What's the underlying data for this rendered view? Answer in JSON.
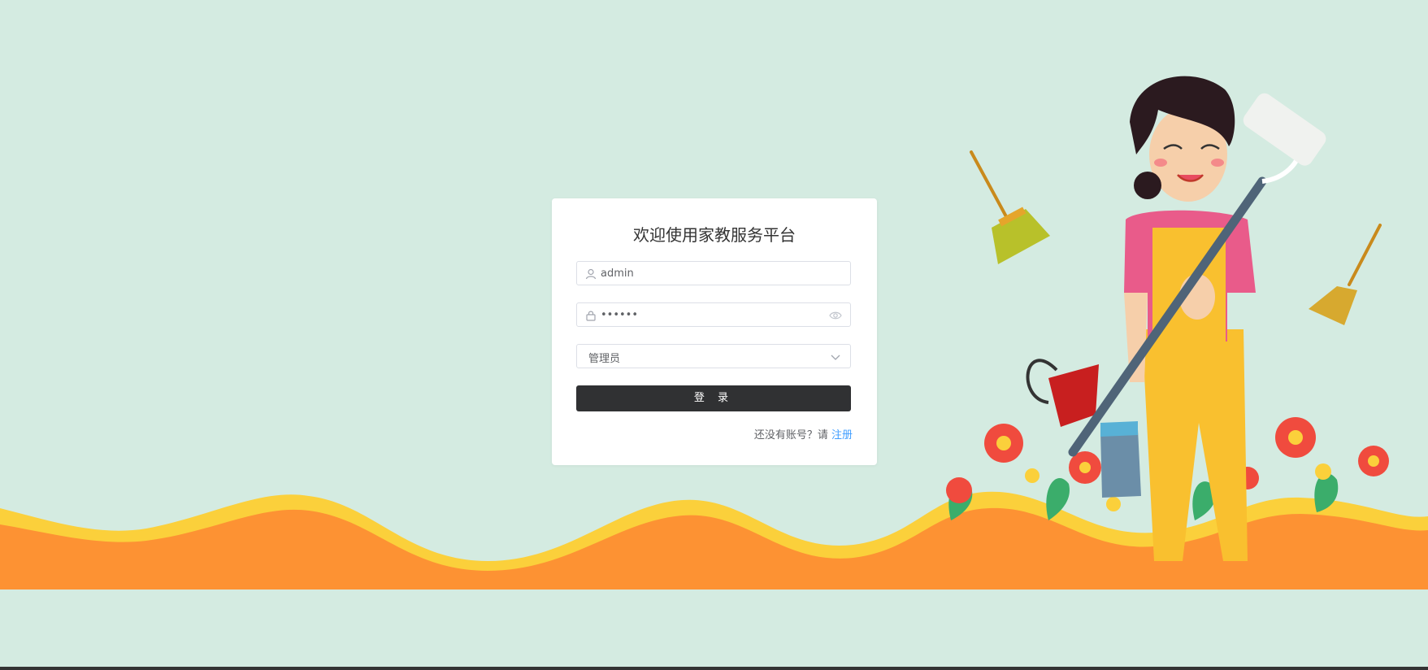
{
  "login": {
    "title": "欢迎使用家教服务平台",
    "username_value": "admin",
    "password_value": "••••••",
    "role_value": "管理员",
    "submit_label": "登 录",
    "register_prompt": "还没有账号？请",
    "register_link": "注册"
  },
  "colors": {
    "background": "#d4ebe1",
    "wave_orange": "#fd9233",
    "wave_yellow": "#fbd03b",
    "button_dark": "#303133",
    "link_blue": "#409eff"
  },
  "icons": {
    "username": "user-icon",
    "password": "lock-icon",
    "password_toggle": "eye-icon",
    "role_dropdown": "chevron-down-icon"
  }
}
